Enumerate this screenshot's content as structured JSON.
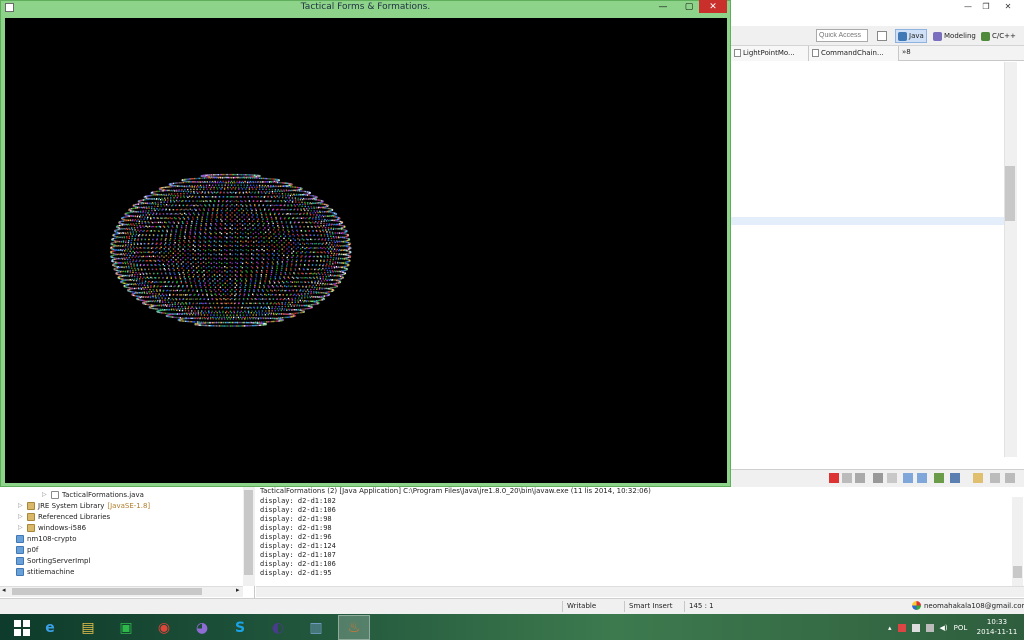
{
  "app_window": {
    "title": "Tactical Forms & Formations.",
    "minimize_glyph": "—",
    "maximize_glyph": "▢",
    "close_glyph": "✕"
  },
  "eclipse": {
    "window_controls": {
      "minimize": "—",
      "restore": "❐",
      "close": "✕"
    },
    "quick_access_placeholder": "Quick Access",
    "perspectives": [
      {
        "label": "Java",
        "color": "#3f78b5"
      },
      {
        "label": "Modeling",
        "color": "#7a6fbf"
      },
      {
        "label": "C/C++",
        "color": "#4f8a3a"
      }
    ],
    "editor_tabs": [
      "LightPointMo...",
      "CommandChain...",
      "»8"
    ],
    "package_explorer": {
      "items": [
        {
          "label": "TacticalFormations.java",
          "kind": "file"
        },
        {
          "label": "JRE System Library",
          "suffix": "[JavaSE-1.8]",
          "kind": "lib"
        },
        {
          "label": "Referenced Libraries",
          "kind": "lib"
        },
        {
          "label": "windows-i586",
          "kind": "lib"
        },
        {
          "label": "nm108-crypto",
          "kind": "proj"
        },
        {
          "label": "p0f",
          "kind": "proj"
        },
        {
          "label": "SortingServerImpl",
          "kind": "proj"
        },
        {
          "label": "stitiemachine",
          "kind": "proj"
        }
      ],
      "scroll_left": "◂",
      "scroll_right": "▸"
    },
    "console": {
      "header": "TacticalFormations (2) [Java Application] C:\\Program Files\\Java\\jre1.8.0_20\\bin\\javaw.exe (11 lis 2014, 10:32:06)",
      "lines": [
        "display: d2-d1:102",
        "display: d2-d1:106",
        "display: d2-d1:98",
        "display: d2-d1:98",
        "display: d2-d1:96",
        "display: d2-d1:124",
        "display: d2-d1:107",
        "display: d2-d1:106",
        "display: d2-d1:95"
      ]
    },
    "status_bar": {
      "writable": "Writable",
      "insert_mode": "Smart Insert",
      "position": "145 : 1",
      "user": "neomahakala108@gmail.com"
    }
  },
  "taskbar": {
    "apps": [
      {
        "name": "internet-explorer",
        "glyph": "e",
        "color": "#3aa0e8"
      },
      {
        "name": "file-explorer",
        "glyph": "▤",
        "color": "#e8c24a"
      },
      {
        "name": "store",
        "glyph": "▣",
        "color": "#2fb84a"
      },
      {
        "name": "chrome",
        "glyph": "◉",
        "color": "#e0453a"
      },
      {
        "name": "pidgin",
        "glyph": "◕",
        "color": "#8f6bd6"
      },
      {
        "name": "skype",
        "glyph": "S",
        "color": "#1aa3e6"
      },
      {
        "name": "eclipse",
        "glyph": "◐",
        "color": "#4a3c8c"
      },
      {
        "name": "notepad",
        "glyph": "▥",
        "color": "#7aa8d6"
      },
      {
        "name": "java",
        "glyph": "♨",
        "color": "#e0762a"
      }
    ],
    "tray": {
      "language": "POL",
      "time": "10:33",
      "date": "2014-11-11"
    }
  },
  "colors": {
    "window_frame": "#8dd38a",
    "canvas": "#000000",
    "close_button": "#c9302c"
  }
}
